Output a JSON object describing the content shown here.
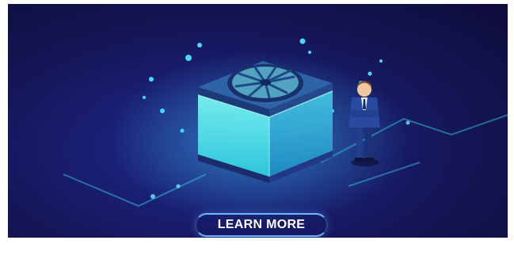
{
  "banner": {
    "cta_label": "LEARN MORE"
  },
  "icons": [
    "server-cube-icon",
    "fan-icon",
    "businessman-icon",
    "circuit-line-icon"
  ],
  "colors": {
    "background_dark": "#0e0c3a",
    "background_mid": "#1a1f73",
    "cube_glow": "#5ff3f0",
    "cube_top": "#2f63a8",
    "accent_line": "#3ad6e6",
    "button_border": "#6fb6ff"
  }
}
